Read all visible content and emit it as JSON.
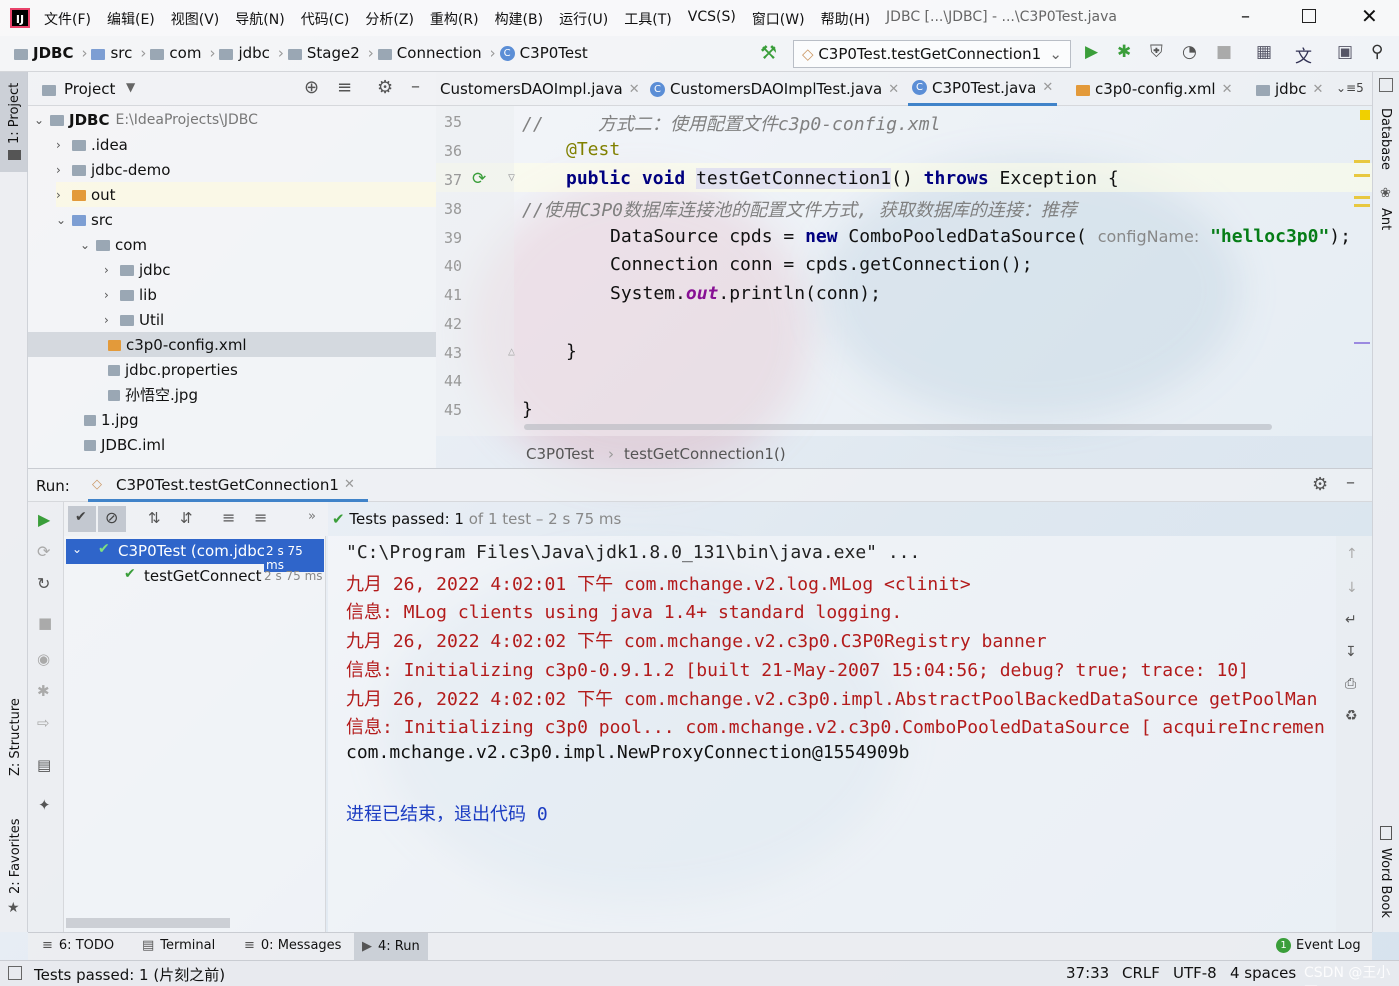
{
  "window": {
    "title": "JDBC [...\\JDBC] - ...\\C3P0Test.java",
    "menu": [
      "文件(F)",
      "编辑(E)",
      "视图(V)",
      "导航(N)",
      "代码(C)",
      "分析(Z)",
      "重构(R)",
      "构建(B)",
      "运行(U)",
      "工具(T)",
      "VCS(S)",
      "窗口(W)",
      "帮助(H)"
    ]
  },
  "breadcrumb": [
    "JDBC",
    "src",
    "com",
    "jdbc",
    "Stage2",
    "Connection",
    "C3P0Test"
  ],
  "run_config": "C3P0Test.testGetConnection1",
  "left_tools": {
    "project": "1: Project",
    "structure": "Z: Structure",
    "favorites": "2: Favorites"
  },
  "right_tools": {
    "database": "Database",
    "ant": "Ant",
    "wordbook": "Word Book"
  },
  "project": {
    "title": "Project",
    "tree": [
      {
        "label": "JDBC",
        "detail": "E:\\IdeaProjects\\JDBC"
      },
      {
        "label": ".idea"
      },
      {
        "label": "jdbc-demo"
      },
      {
        "label": "out"
      },
      {
        "label": "src"
      },
      {
        "label": "com"
      },
      {
        "label": "jdbc"
      },
      {
        "label": "lib"
      },
      {
        "label": "Util"
      },
      {
        "label": "c3p0-config.xml"
      },
      {
        "label": "jdbc.properties"
      },
      {
        "label": "孙悟空.jpg"
      },
      {
        "label": "1.jpg"
      },
      {
        "label": "JDBC.iml"
      }
    ]
  },
  "editor": {
    "tabs": [
      "CustomersDAOImpl.java",
      "CustomersDAOImplTest.java",
      "C3P0Test.java",
      "c3p0-config.xml",
      "jdbc"
    ],
    "tab_count": "5",
    "lines": [
      "35",
      "36",
      "37",
      "38",
      "39",
      "40",
      "41",
      "42",
      "43",
      "44",
      "45"
    ],
    "code": {
      "l35": "//     方式二：使用配置文件c3p0-config.xml",
      "l36": "@Test",
      "l37_kw": "public void",
      "l37_name": "testGetConnection1",
      "l37_rest": "() ",
      "l37_throws": "throws",
      "l37_end": " Exception {",
      "l38": "//使用C3P0数据库连接池的配置文件方式, 获取数据库的连接：推荐",
      "l39_a": "DataSource cpds = ",
      "l39_new": "new",
      "l39_b": " ComboPooledDataSource( ",
      "l39_hint": "configName:",
      "l39_str": " \"helloc3p0\"",
      "l39_c": ");",
      "l40": "Connection conn = cpds.getConnection();",
      "l41_a": "System.",
      "l41_out": "out",
      "l41_b": ".println(conn);",
      "l43": "}",
      "l45": "}"
    },
    "breadcrumb": [
      "C3P0Test",
      "testGetConnection1()"
    ]
  },
  "run": {
    "label": "Run:",
    "tab": "C3P0Test.testGetConnection1",
    "status_prefix": "Tests passed:",
    "status_count": "1",
    "status_suffix": "of 1 test – 2 s 75 ms",
    "tree": [
      {
        "label": "C3P0Test (com.jdbc",
        "time": "2 s 75 ms"
      },
      {
        "label": "testGetConnect",
        "time": "2 s 75 ms"
      }
    ],
    "console": [
      "\"C:\\Program Files\\Java\\jdk1.8.0_131\\bin\\java.exe\" ...",
      "九月 26, 2022 4:02:01 下午 com.mchange.v2.log.MLog <clinit>",
      "信息: MLog clients using java 1.4+ standard logging.",
      "九月 26, 2022 4:02:02 下午 com.mchange.v2.c3p0.C3P0Registry banner",
      "信息: Initializing c3p0-0.9.1.2 [built 21-May-2007 15:04:56; debug? true; trace: 10]",
      "九月 26, 2022 4:02:02 下午 com.mchange.v2.c3p0.impl.AbstractPoolBackedDataSource getPoolMan",
      "信息: Initializing c3p0 pool... com.mchange.v2.c3p0.ComboPooledDataSource [ acquireIncremen",
      "com.mchange.v2.c3p0.impl.NewProxyConnection@1554909b",
      "进程已结束，退出代码 0"
    ]
  },
  "bottom_tabs": [
    "6: TODO",
    "Terminal",
    "0: Messages",
    "4: Run"
  ],
  "event_log": {
    "count": "1",
    "label": "Event Log"
  },
  "status": {
    "message": "Tests passed: 1 (片刻之前)",
    "position": "37:33",
    "line_sep": "CRLF",
    "encoding": "UTF-8",
    "indent": "4 spaces",
    "watermark": "CSDN @王小耳"
  },
  "colors": {
    "accent": "#4083c9",
    "run_green": "#3a9e3a",
    "error_red": "#b31b1b"
  }
}
